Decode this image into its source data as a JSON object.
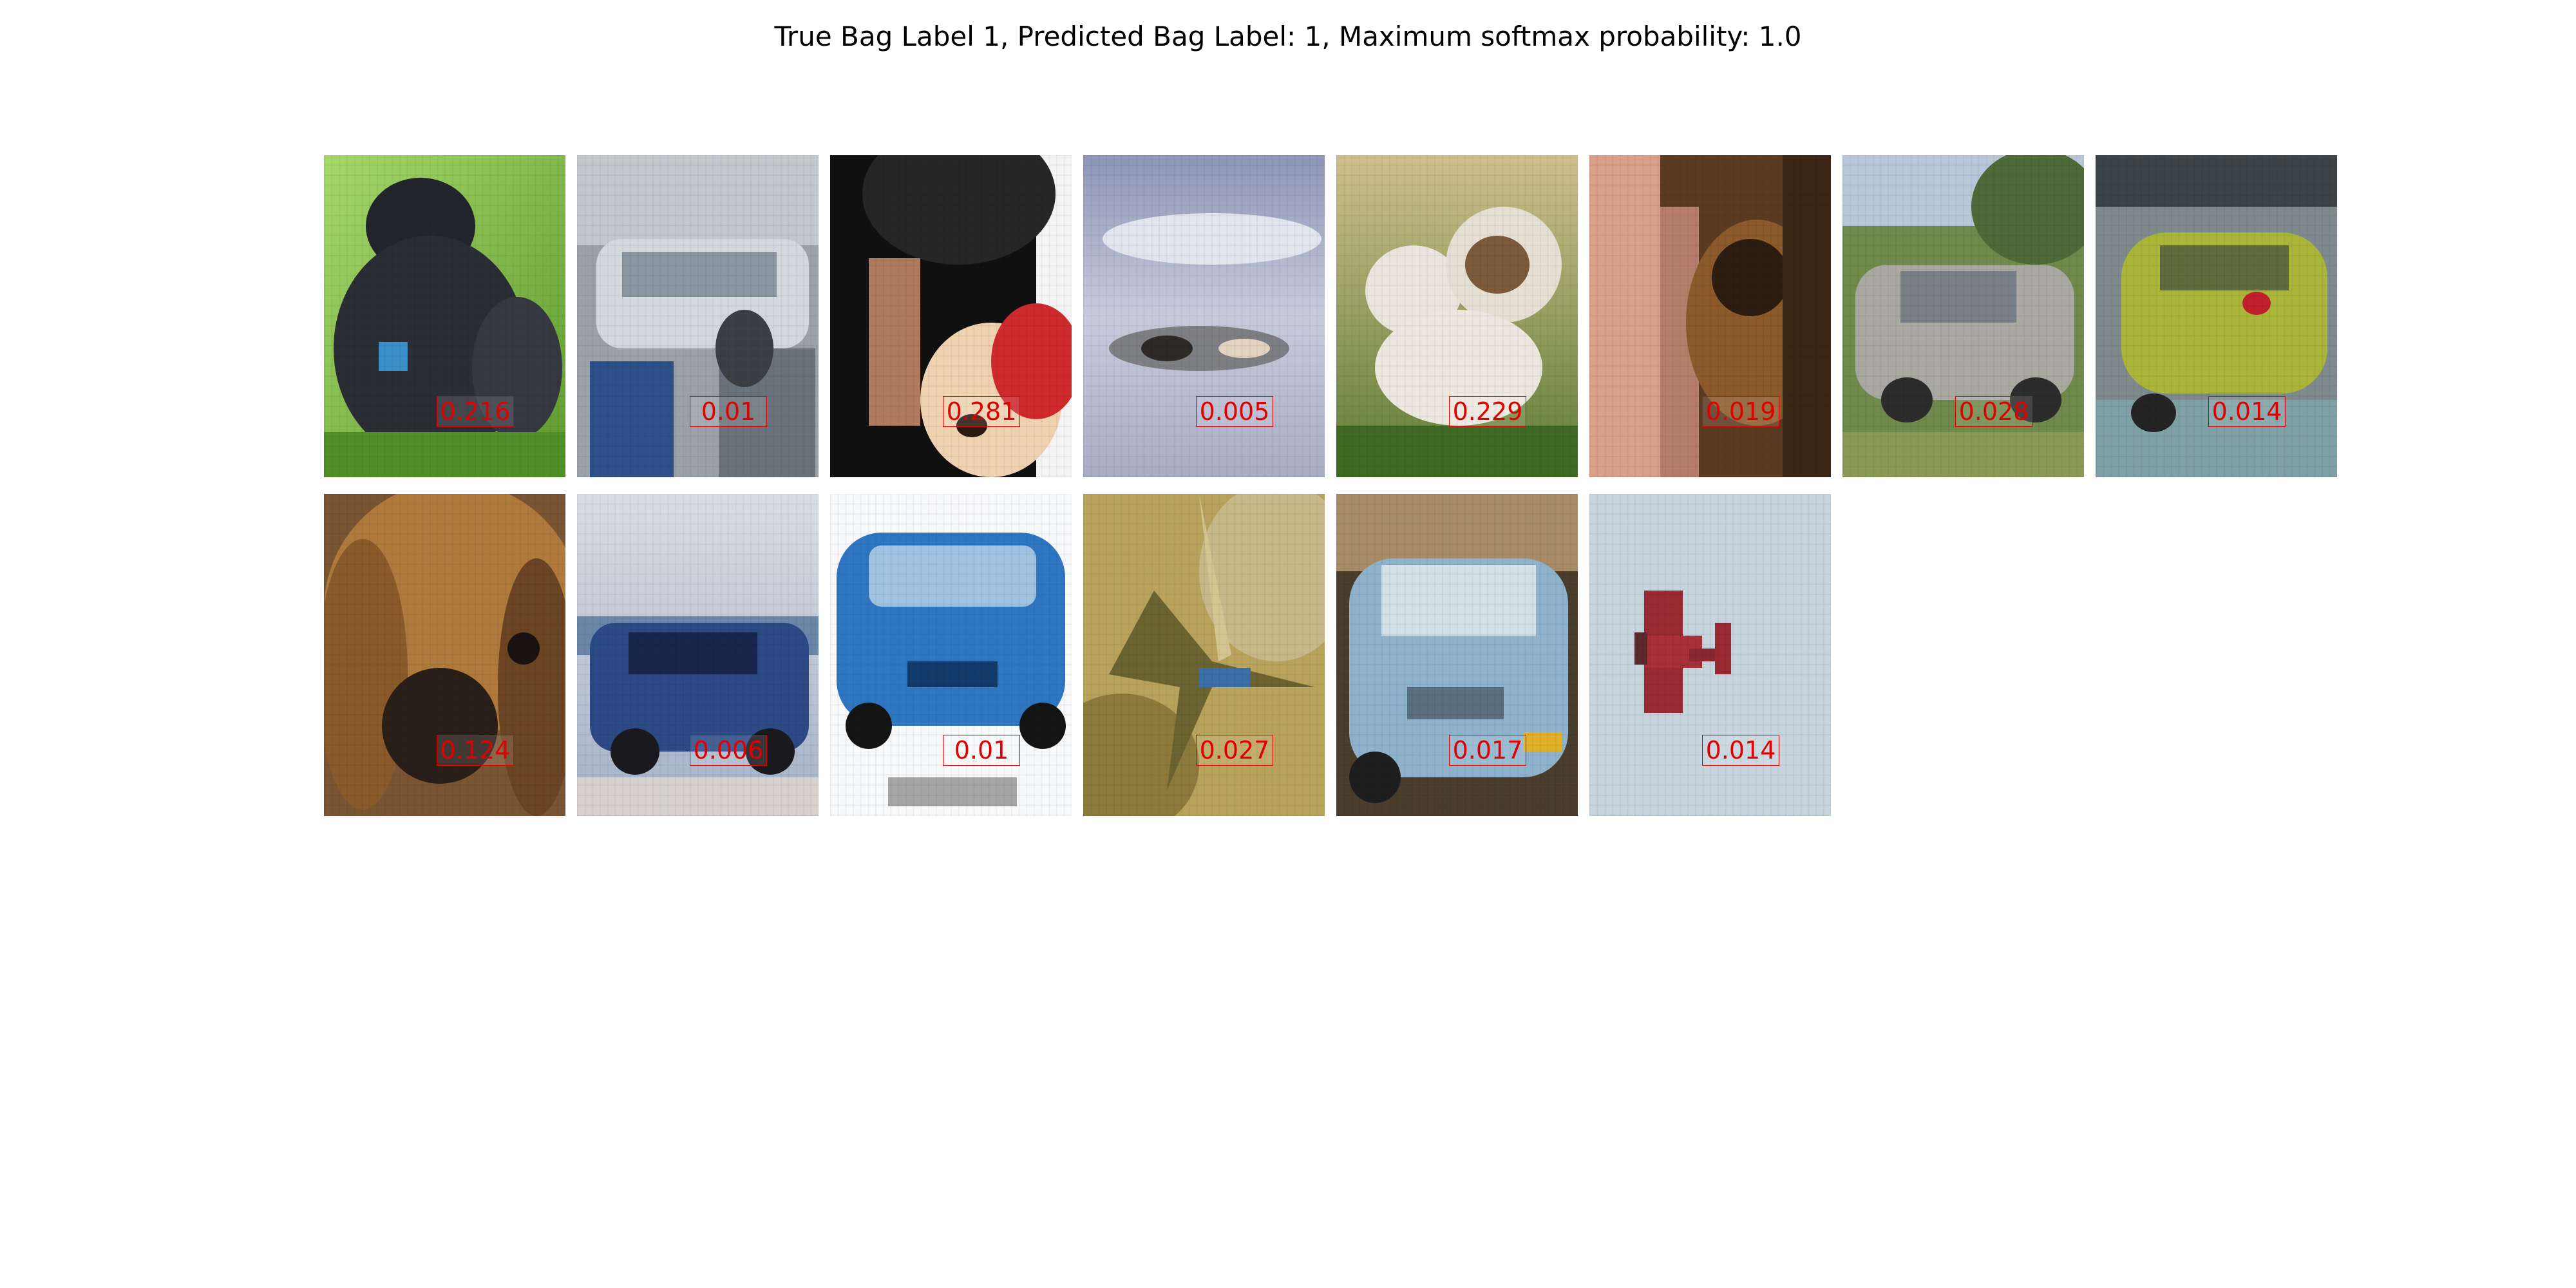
{
  "figure": {
    "title": "True Bag Label 1, Predicted Bag Label: 1, Maximum softmax probability: 1.0"
  },
  "instances": [
    {
      "subject": "black-dog",
      "score": "0.216"
    },
    {
      "subject": "silver-car",
      "score": "0.01"
    },
    {
      "subject": "person-holding-dog",
      "score": "0.281"
    },
    {
      "subject": "airplane",
      "score": "0.005"
    },
    {
      "subject": "white-dog",
      "score": "0.229"
    },
    {
      "subject": "brown-dog",
      "score": "0.019"
    },
    {
      "subject": "silver-car",
      "score": "0.028"
    },
    {
      "subject": "green-car",
      "score": "0.014"
    },
    {
      "subject": "brown-dog",
      "score": "0.124"
    },
    {
      "subject": "blue-car",
      "score": "0.006"
    },
    {
      "subject": "blue-car",
      "score": "0.01"
    },
    {
      "subject": "airplane",
      "score": "0.027"
    },
    {
      "subject": "light-blue-car",
      "score": "0.017"
    },
    {
      "subject": "red-airplane",
      "score": "0.014"
    }
  ],
  "colors": {
    "score_text": "#e00000",
    "score_border": "#e00000",
    "background": "#ffffff"
  }
}
